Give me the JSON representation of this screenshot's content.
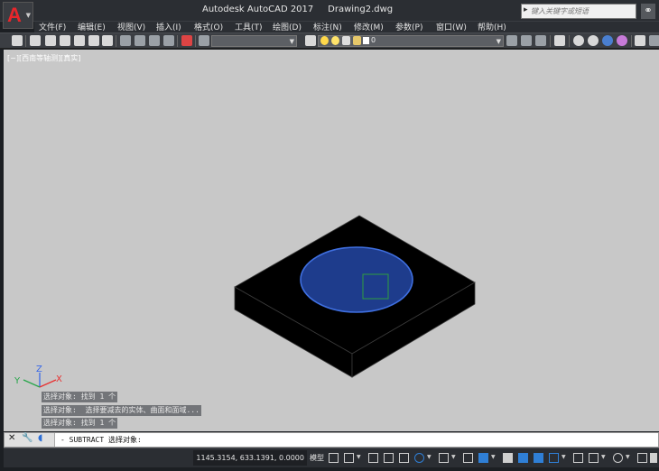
{
  "app": {
    "title": "Autodesk AutoCAD 2017     Drawing2.dwg",
    "logo_letter": "A",
    "search_placeholder": "键入关键字或短语"
  },
  "menu": [
    {
      "label": "文件(F)"
    },
    {
      "label": "编辑(E)"
    },
    {
      "label": "视图(V)"
    },
    {
      "label": "插入(I)"
    },
    {
      "label": "格式(O)"
    },
    {
      "label": "工具(T)"
    },
    {
      "label": "绘图(D)"
    },
    {
      "label": "标注(N)"
    },
    {
      "label": "修改(M)"
    },
    {
      "label": "参数(P)"
    },
    {
      "label": "窗口(W)"
    },
    {
      "label": "帮助(H)"
    }
  ],
  "toolbar": {
    "layer_value": "0"
  },
  "viewport": {
    "label": "[−][西南等轴测][真实]",
    "background": "#c8c8c8",
    "ucs": {
      "x": "X",
      "y": "Y",
      "z": "Z"
    }
  },
  "history": [
    "选择对象: 找到 1 个",
    "选择对象:  选择要减去的实体、曲面和面域...",
    "选择对象: 找到 1 个"
  ],
  "command": {
    "text": "- SUBTRACT 选择对象:"
  },
  "status": {
    "coords": "1145.3154, 633.1391, 0.0000",
    "model_label": "模型"
  },
  "colors": {
    "accent_red": "#e8262b",
    "selection_blue": "#1e3c8c",
    "grip_green": "#2e9e3e"
  }
}
